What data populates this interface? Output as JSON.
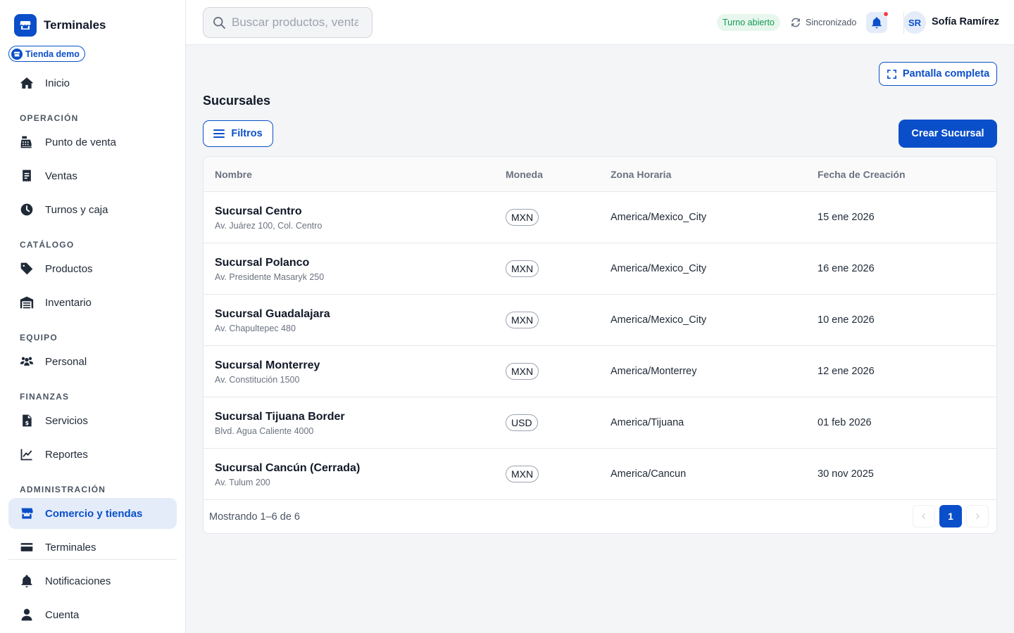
{
  "sidebar": {
    "brand_title": "Terminales",
    "store_pill": "Tienda demo",
    "home": "Inicio",
    "sections": {
      "operacion": "OPERACIÓN",
      "catalogo": "CATÁLOGO",
      "equipo": "EQUIPO",
      "finanzas": "FINANZAS",
      "administracion": "ADMINISTRACIÓN"
    },
    "items": {
      "punto_venta": "Punto de venta",
      "ventas": "Ventas",
      "turnos": "Turnos y caja",
      "productos": "Productos",
      "inventario": "Inventario",
      "personal": "Personal",
      "servicios": "Servicios",
      "reportes": "Reportes",
      "comercio": "Comercio y tiendas",
      "terminales": "Terminales",
      "notificaciones": "Notificaciones",
      "cuenta": "Cuenta"
    }
  },
  "topbar": {
    "search_placeholder": "Buscar productos, ventas...",
    "shift_status": "Turno abierto",
    "sync_status": "Sincronizado",
    "avatar_initials": "SR",
    "user_name": "Sofía Ramírez"
  },
  "main": {
    "fullscreen_label": "Pantalla completa",
    "title": "Sucursales",
    "filter_label": "Filtros",
    "create_label": "Crear Sucursal",
    "columns": {
      "name": "Nombre",
      "currency": "Moneda",
      "timezone": "Zona Horaria",
      "created": "Fecha de Creación"
    },
    "rows": [
      {
        "name": "Sucursal Centro",
        "address": "Av. Juárez 100, Col. Centro",
        "currency": "MXN",
        "timezone": "America/Mexico_City",
        "created": "15 ene 2026"
      },
      {
        "name": "Sucursal Polanco",
        "address": "Av. Presidente Masaryk 250",
        "currency": "MXN",
        "timezone": "America/Mexico_City",
        "created": "16 ene 2026"
      },
      {
        "name": "Sucursal Guadalajara",
        "address": "Av. Chapultepec 480",
        "currency": "MXN",
        "timezone": "America/Mexico_City",
        "created": "10 ene 2026"
      },
      {
        "name": "Sucursal Monterrey",
        "address": "Av. Constitución 1500",
        "currency": "MXN",
        "timezone": "America/Monterrey",
        "created": "12 ene 2026"
      },
      {
        "name": "Sucursal Tijuana Border",
        "address": "Blvd. Agua Caliente 4000",
        "currency": "USD",
        "timezone": "America/Tijuana",
        "created": "01 feb 2026"
      },
      {
        "name": "Sucursal Cancún (Cerrada)",
        "address": "Av. Tulum 200",
        "currency": "MXN",
        "timezone": "America/Cancun",
        "created": "30 nov 2025"
      }
    ],
    "footer_text": "Mostrando 1–6 de 6",
    "current_page": "1",
    "prev_glyph": "‹",
    "next_glyph": "›"
  },
  "colors": {
    "accent": "#0a4fc9",
    "accent_soft": "#e4ecfa",
    "success": "#149a52",
    "alert_dot": "#ef4444"
  },
  "icons": [
    "store-icon",
    "home-icon",
    "cash-register-icon",
    "receipt-icon",
    "clock-icon",
    "tag-icon",
    "warehouse-icon",
    "users-icon",
    "invoice-dollar-icon",
    "chart-line-icon",
    "card-icon",
    "bell-icon",
    "user-icon",
    "search-icon",
    "sync-icon",
    "expand-icon",
    "filter-lines-icon"
  ]
}
